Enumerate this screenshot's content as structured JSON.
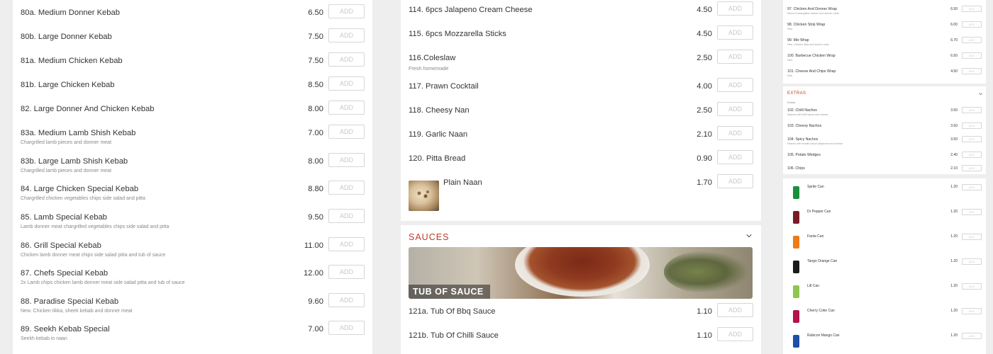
{
  "add_label": "ADD",
  "column1": {
    "items": [
      {
        "name": "80a. Medium Donner Kebab",
        "desc": "",
        "price": "6.50"
      },
      {
        "name": "80b. Large Donner Kebab",
        "desc": "",
        "price": "7.50"
      },
      {
        "name": "81a. Medium Chicken Kebab",
        "desc": "",
        "price": "7.50"
      },
      {
        "name": "81b. Large Chicken Kebab",
        "desc": "",
        "price": "8.50"
      },
      {
        "name": "82. Large Donner And Chicken Kebab",
        "desc": "",
        "price": "8.00"
      },
      {
        "name": "83a. Medium Lamb Shish Kebab",
        "desc": "Chargrilled lamb pieces and donner meat",
        "price": "7.00"
      },
      {
        "name": "83b. Large Lamb Shish Kebab",
        "desc": "Chargrilled lamb pieces and donner meat",
        "price": "8.00"
      },
      {
        "name": "84. Large Chicken Special Kebab",
        "desc": "Chargrilled chicken vegetables chips side salad and pitta",
        "price": "8.80"
      },
      {
        "name": "85. Lamb Special Kebab",
        "desc": "Lamb donner meat chargrilled vegetables chips side salad and pitta",
        "price": "9.50"
      },
      {
        "name": "86. Grill Special Kebab",
        "desc": "Chicken lamb donner meat chips side salad pitta and tub of sauce",
        "price": "11.00"
      },
      {
        "name": "87. Chefs Special Kebab",
        "desc": "2x Lamb chips chicken lamb donner meat side salad pitta and tub of sauce",
        "price": "12.00"
      },
      {
        "name": "88. Paradise Special Kebab",
        "desc": "New. Chicken tikka, sheek kebab and donner meat",
        "price": "9.60"
      },
      {
        "name": "89. Seekh Kebab Special",
        "desc": "Seekh kebab in naan",
        "price": "7.00"
      }
    ]
  },
  "column2": {
    "items": [
      {
        "name": "114. 6pcs Jalapeno Cream Cheese",
        "desc": "",
        "price": "4.50"
      },
      {
        "name": "115. 6pcs Mozzarella Sticks",
        "desc": "",
        "price": "4.50"
      },
      {
        "name": "116.Coleslaw",
        "desc": "Fresh homemade",
        "price": "2.50"
      },
      {
        "name": "117. Prawn Cocktail",
        "desc": "",
        "price": "4.00"
      },
      {
        "name": "118. Cheesy Nan",
        "desc": "",
        "price": "2.50"
      },
      {
        "name": "119. Garlic Naan",
        "desc": "",
        "price": "2.10"
      },
      {
        "name": "120. Pitta Bread",
        "desc": "",
        "price": "0.90"
      }
    ],
    "image_item": {
      "name": "Plain Naan",
      "price": "1.70"
    },
    "sauces": {
      "title": "SAUCES",
      "banner_label": "TUB OF SAUCE",
      "items": [
        {
          "name": "121a. Tub Of Bbq Sauce",
          "price": "1.10"
        },
        {
          "name": "121b. Tub Of Chilli Sauce",
          "price": "1.10"
        }
      ]
    }
  },
  "column3": {
    "wraps": [
      {
        "name": "97. Chicken And Donner Wrap",
        "desc": "Mixed of chargrilled chicken and donner meat",
        "price": "6.50"
      },
      {
        "name": "98. Chicken Strip Wrap",
        "desc": "New",
        "price": "6.00"
      },
      {
        "name": "99. Mix Wrap",
        "desc": "New. Chicken tikka and donner meat",
        "price": "6.70"
      },
      {
        "name": "100. Barbecue Chicken Wrap",
        "desc": "New",
        "price": "6.50"
      },
      {
        "name": "101. Cheese And Chips Wrap",
        "desc": "New",
        "price": "4.50"
      }
    ],
    "extras": {
      "title": "EXTRAS",
      "subtitle": "Extras",
      "items": [
        {
          "name": "102. Chilli Nachos",
          "desc": "Nachos with chilli sauce and cheese",
          "price": "3.50"
        },
        {
          "name": "103. Cheesy Nachos",
          "desc": "",
          "price": "3.50"
        },
        {
          "name": "104. Spicy Nachos",
          "desc": "Nachos with tomato sauce jalapenos and cheese",
          "price": "3.50"
        },
        {
          "name": "105. Potato Wedges",
          "desc": "",
          "price": "2.40"
        },
        {
          "name": "106. Chips",
          "desc": "",
          "price": "2.10"
        }
      ]
    },
    "drinks": [
      {
        "name": "Sprite Can",
        "price": "1.20",
        "color": "#1a8f3c"
      },
      {
        "name": "Dr Pepper Can",
        "price": "1.20",
        "color": "#7a1c24"
      },
      {
        "name": "Fanta Can",
        "price": "1.20",
        "color": "#f07a18"
      },
      {
        "name": "Tango Orange Can",
        "price": "1.20",
        "color": "#1b1b1b"
      },
      {
        "name": "Lilt Can",
        "price": "1.20",
        "color": "#8fc552"
      },
      {
        "name": "Cherry Coke Can",
        "price": "1.20",
        "color": "#b3124a"
      },
      {
        "name": "Rubicon Mango Can",
        "price": "1.20",
        "color": "#1d4fa8"
      }
    ]
  }
}
